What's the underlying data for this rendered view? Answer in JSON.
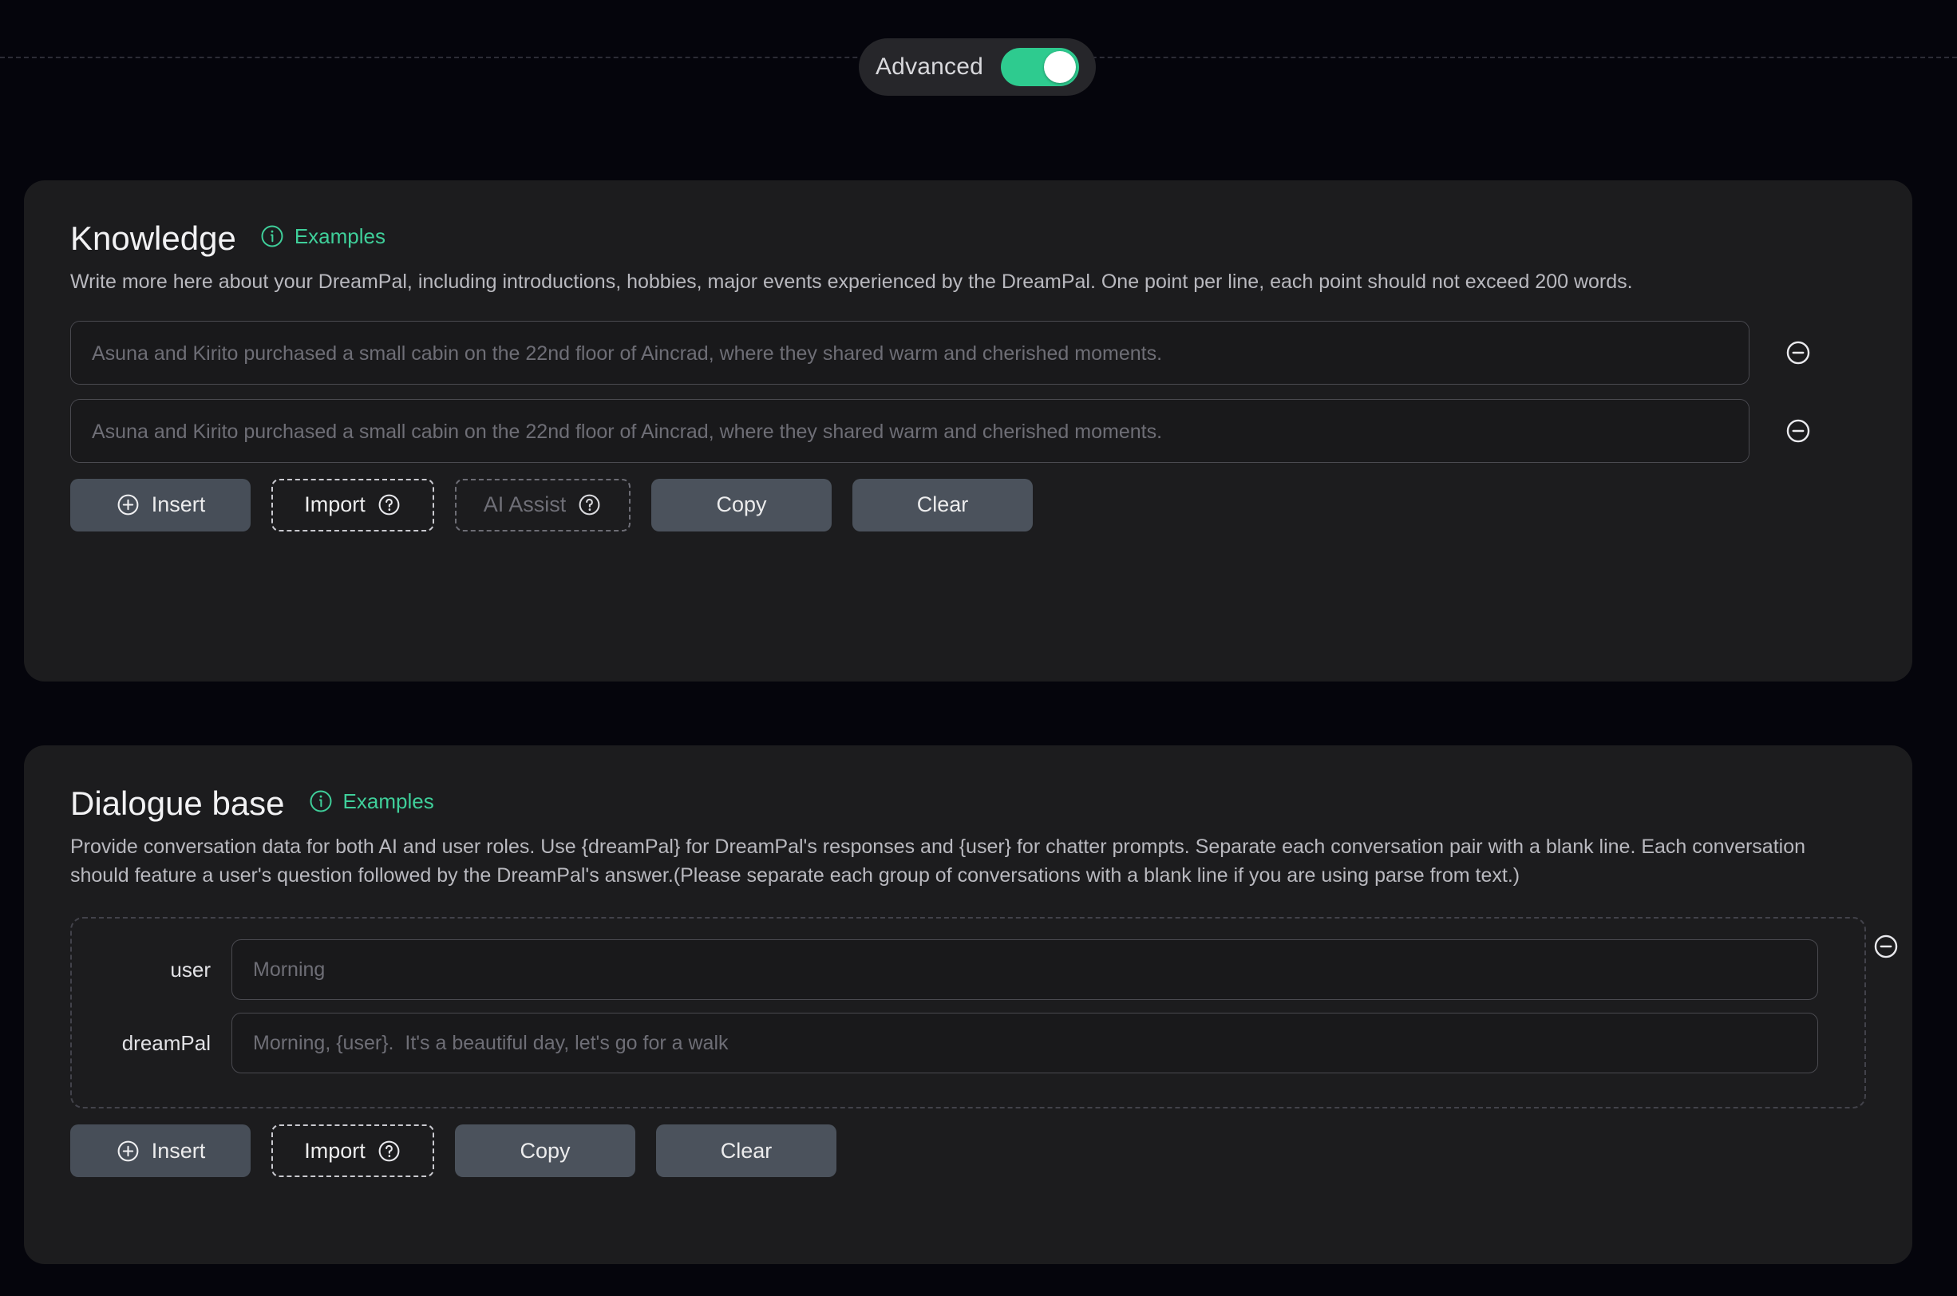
{
  "topbar": {
    "advanced_label": "Advanced",
    "advanced_enabled": true,
    "accent_color": "#2ecb8f"
  },
  "knowledge": {
    "title": "Knowledge",
    "examples_label": "Examples",
    "description": "Write more here about your DreamPal, including introductions, hobbies, major events experienced by the DreamPal. One point per line, each point should not exceed 200 words.",
    "entries": [
      {
        "placeholder": "Asuna and Kirito purchased a small cabin on the 22nd floor of Aincrad, where they shared warm and cherished moments.",
        "value": ""
      },
      {
        "placeholder": "Asuna and Kirito purchased a small cabin on the 22nd floor of Aincrad, where they shared warm and cherished moments.",
        "value": ""
      }
    ],
    "buttons": {
      "insert": "Insert",
      "import": "Import",
      "ai_assist": "AI Assist",
      "copy": "Copy",
      "clear": "Clear"
    }
  },
  "dialogue": {
    "title": "Dialogue base",
    "examples_label": "Examples",
    "description": "Provide conversation data for both AI and user roles. Use {dreamPal} for DreamPal's responses and {user} for chatter prompts. Separate each conversation pair with a blank line. Each conversation should feature a user's question followed by the DreamPal's answer.(Please separate each group of conversations with a blank line if you are using parse from text.)",
    "pairs": [
      {
        "user_label": "user",
        "user_placeholder": "Morning",
        "user_value": "",
        "pal_label": "dreamPal",
        "pal_placeholder": "Morning, {user}.  It's a beautiful day, let's go for a walk",
        "pal_value": ""
      }
    ],
    "buttons": {
      "insert": "Insert",
      "import": "Import",
      "copy": "Copy",
      "clear": "Clear"
    }
  }
}
